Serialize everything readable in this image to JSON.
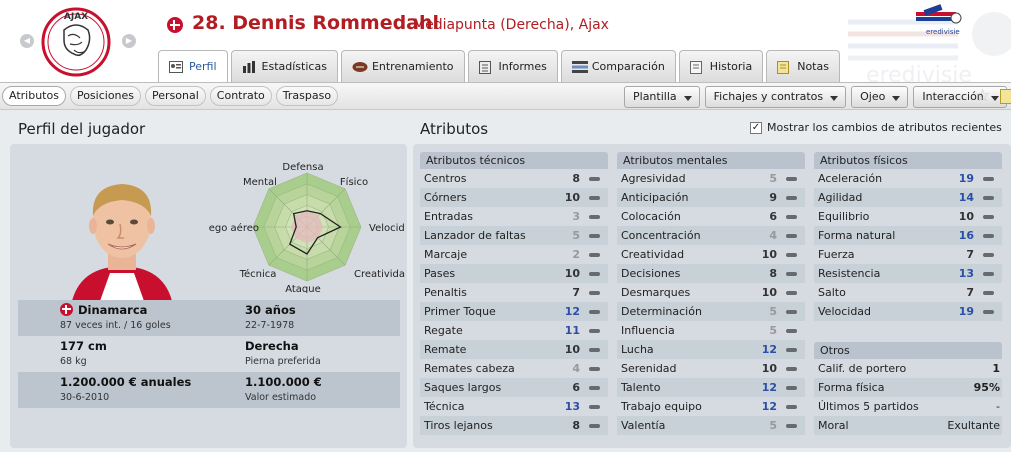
{
  "header": {
    "club_logo_text": "AJAX AMSTERDAM",
    "player_name": "28. Dennis Rommedahl",
    "player_sub": "Mediapunta (Derecha), Ajax",
    "league_logo_text": "eredivisie"
  },
  "tabs": [
    {
      "label": "Perfil",
      "icon": "profile-icon",
      "active": true
    },
    {
      "label": "Estadísticas",
      "icon": "bar-chart-icon",
      "active": false
    },
    {
      "label": "Entrenamiento",
      "icon": "ball-icon",
      "active": false
    },
    {
      "label": "Informes",
      "icon": "document-icon",
      "active": false
    },
    {
      "label": "Comparación",
      "icon": "compare-icon",
      "active": false
    },
    {
      "label": "Historia",
      "icon": "history-icon",
      "active": false
    },
    {
      "label": "Notas",
      "icon": "notes-icon",
      "active": false
    }
  ],
  "subtabs": [
    {
      "label": "Atributos",
      "active": true
    },
    {
      "label": "Posiciones",
      "active": false
    },
    {
      "label": "Personal",
      "active": false
    },
    {
      "label": "Contrato",
      "active": false
    },
    {
      "label": "Traspaso",
      "active": false
    }
  ],
  "dropdowns": [
    {
      "label": "Plantilla"
    },
    {
      "label": "Fichajes y contratos"
    },
    {
      "label": "Ojeo"
    },
    {
      "label": "Interacción"
    }
  ],
  "profile": {
    "title": "Perfil del jugador",
    "nationality": "Dinamarca",
    "caps": "87 veces int. / 16 goles",
    "age": "30 años",
    "birth_date": "22-7-1978",
    "height": "177 cm",
    "weight": "68 kg",
    "foot": "Derecha",
    "foot_label": "Pierna preferida",
    "wage": "1.200.000 € anuales",
    "contract_end": "30-6-2010",
    "value": "1.100.000 €",
    "value_label": "Valor estimado"
  },
  "radar": {
    "labels": {
      "top": "Defensa",
      "top_right": "Físico",
      "right": "Velocidad",
      "bottom_right": "Creatividad",
      "bottom": "Ataque",
      "bottom_left": "Técnica",
      "left": "Juego aéreo",
      "top_left": "Mental"
    },
    "levels": [
      0.3,
      0.35,
      0.62,
      0.28,
      0.5,
      0.45,
      0.2,
      0.35
    ],
    "colors": {
      "fill_outer": "#b9d49b",
      "fill_inner": "#e2bcbc",
      "stroke": "#222222"
    }
  },
  "attributes": {
    "title": "Atributos",
    "recent_changes_label": "Mostrar los cambios de atributos recientes",
    "recent_changes_checked": true,
    "technical": {
      "title": "Atributos técnicos",
      "items": [
        {
          "name": "Centros",
          "value": 8
        },
        {
          "name": "Córners",
          "value": 10
        },
        {
          "name": "Entradas",
          "value": 3
        },
        {
          "name": "Lanzador de faltas",
          "value": 5
        },
        {
          "name": "Marcaje",
          "value": 2
        },
        {
          "name": "Pases",
          "value": 10
        },
        {
          "name": "Penaltis",
          "value": 7
        },
        {
          "name": "Primer Toque",
          "value": 12
        },
        {
          "name": "Regate",
          "value": 11
        },
        {
          "name": "Remate",
          "value": 10
        },
        {
          "name": "Remates cabeza",
          "value": 4
        },
        {
          "name": "Saques largos",
          "value": 6
        },
        {
          "name": "Técnica",
          "value": 13
        },
        {
          "name": "Tiros lejanos",
          "value": 8
        }
      ]
    },
    "mental": {
      "title": "Atributos mentales",
      "items": [
        {
          "name": "Agresividad",
          "value": 5
        },
        {
          "name": "Anticipación",
          "value": 9
        },
        {
          "name": "Colocación",
          "value": 6
        },
        {
          "name": "Concentración",
          "value": 4
        },
        {
          "name": "Creatividad",
          "value": 10
        },
        {
          "name": "Decisiones",
          "value": 8
        },
        {
          "name": "Desmarques",
          "value": 10
        },
        {
          "name": "Determinación",
          "value": 5
        },
        {
          "name": "Influencia",
          "value": 5
        },
        {
          "name": "Lucha",
          "value": 12
        },
        {
          "name": "Serenidad",
          "value": 10
        },
        {
          "name": "Talento",
          "value": 12
        },
        {
          "name": "Trabajo equipo",
          "value": 12
        },
        {
          "name": "Valentía",
          "value": 5
        }
      ]
    },
    "physical": {
      "title": "Atributos físicos",
      "items": [
        {
          "name": "Aceleración",
          "value": 19
        },
        {
          "name": "Agilidad",
          "value": 14
        },
        {
          "name": "Equilibrio",
          "value": 10
        },
        {
          "name": "Forma natural",
          "value": 16
        },
        {
          "name": "Fuerza",
          "value": 7
        },
        {
          "name": "Resistencia",
          "value": 13
        },
        {
          "name": "Salto",
          "value": 7
        },
        {
          "name": "Velocidad",
          "value": 19
        }
      ]
    },
    "other": {
      "title": "Otros",
      "items": [
        {
          "name": "Calif. de portero",
          "value": "1"
        },
        {
          "name": "Forma física",
          "value": "95%"
        },
        {
          "name": "Últimos 5 partidos",
          "value": "-"
        },
        {
          "name": "Moral",
          "value": "Exultante"
        }
      ]
    }
  },
  "colors": {
    "accent_red": "#b11d22",
    "high_value": "#2a4fa4",
    "card_bg": "#d6dbe1"
  }
}
